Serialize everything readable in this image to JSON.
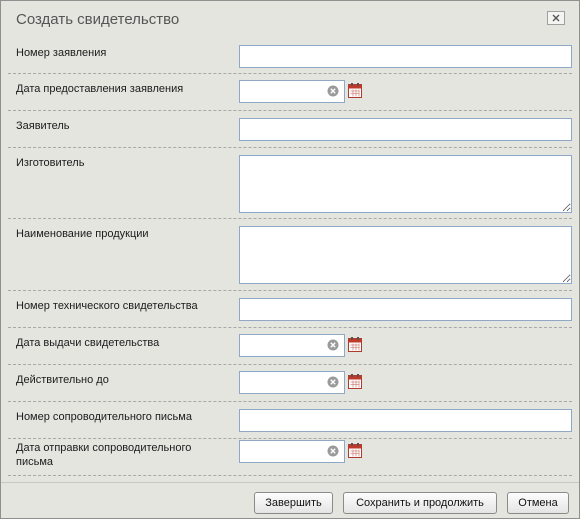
{
  "dialog": {
    "title": "Создать свидетельство",
    "close_icon": "close-icon"
  },
  "fields": {
    "application_number": {
      "label": "Номер заявления",
      "value": ""
    },
    "application_date": {
      "label": "Дата предоставления заявления",
      "value": ""
    },
    "applicant": {
      "label": "Заявитель",
      "value": ""
    },
    "manufacturer": {
      "label": "Изготовитель",
      "value": ""
    },
    "product_name": {
      "label": "Наименование продукции",
      "value": ""
    },
    "tech_certificate_number": {
      "label": "Номер технического свидетельства",
      "value": ""
    },
    "issue_date": {
      "label": "Дата выдачи свидетельства",
      "value": ""
    },
    "valid_until": {
      "label": "Действительно до",
      "value": ""
    },
    "cover_letter_number": {
      "label": "Номер сопроводительного письма",
      "value": ""
    },
    "cover_letter_date": {
      "label": "Дата отправки сопроводительного письма",
      "value": ""
    }
  },
  "icons": {
    "clear": "clear-icon",
    "calendar": "calendar-icon"
  },
  "footer": {
    "finish_label": "Завершить",
    "save_continue_label": "Сохранить и продолжить",
    "cancel_label": "Отмена"
  },
  "colors": {
    "dialog_bg": "#e5e5e0",
    "input_border": "#8fa8c6",
    "calendar_red": "#c0392b"
  }
}
